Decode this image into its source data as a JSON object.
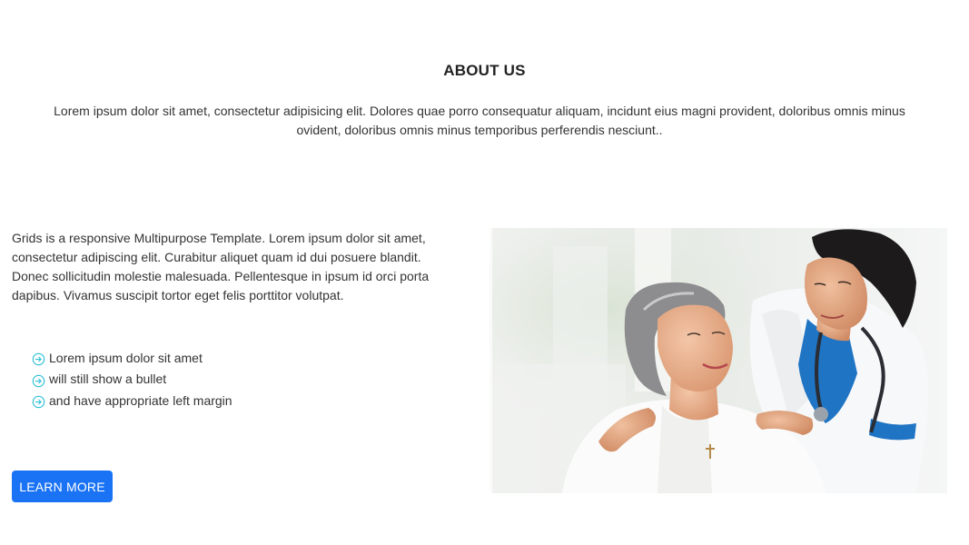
{
  "about": {
    "title": "ABOUT US",
    "intro": "Lorem ipsum dolor sit amet, consectetur adipisicing elit. Dolores quae porro consequatur aliquam, incidunt eius magni provident, doloribus omnis minus ovident, doloribus omnis minus temporibus perferendis nesciunt..",
    "description": "Grids is a responsive Multipurpose Template. Lorem ipsum dolor sit amet, consectetur adipiscing elit. Curabitur aliquet quam id dui posuere blandit. Donec sollicitudin molestie malesuada. Pellentesque in ipsum id orci porta dapibus. Vivamus suscipit tortor eget felis porttitor volutpat.",
    "features": [
      {
        "label": "Lorem ipsum dolor sit amet",
        "icon": "arrow-circle-right-icon"
      },
      {
        "label": "will still show a bullet",
        "icon": "arrow-circle-right-icon"
      },
      {
        "label": "and have appropriate left margin",
        "icon": "arrow-circle-right-icon"
      }
    ],
    "button_label": "LEARN MORE",
    "image_icon": "doctor-with-patient-photo"
  },
  "colors": {
    "accent": "#1a73f5",
    "bullet": "#2bbfd6",
    "text": "#333333",
    "heading": "#222222"
  }
}
